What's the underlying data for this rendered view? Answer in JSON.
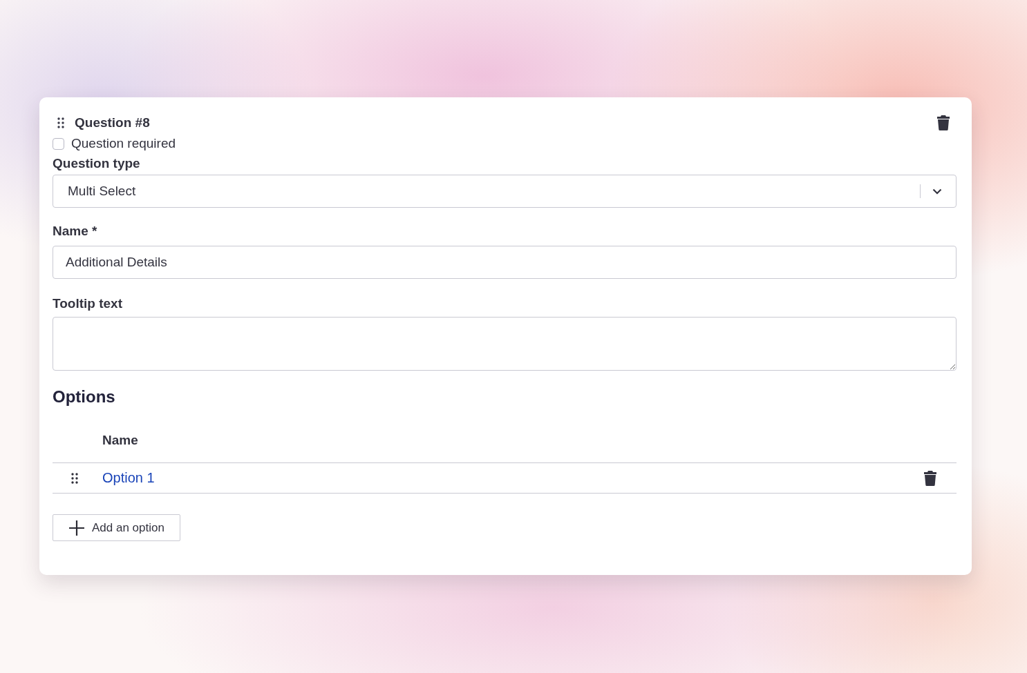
{
  "question": {
    "title": "Question #8",
    "required": {
      "label": "Question required",
      "checked": false
    },
    "type_field": {
      "label": "Question type",
      "value": "Multi Select"
    },
    "name_field": {
      "label": "Name *",
      "value": "Additional Details"
    },
    "tooltip_field": {
      "label": "Tooltip text"
    }
  },
  "options": {
    "heading": "Options",
    "columns": [
      "Name"
    ],
    "rows": [
      {
        "name": "Option 1"
      }
    ],
    "add_button": "Add an option"
  }
}
